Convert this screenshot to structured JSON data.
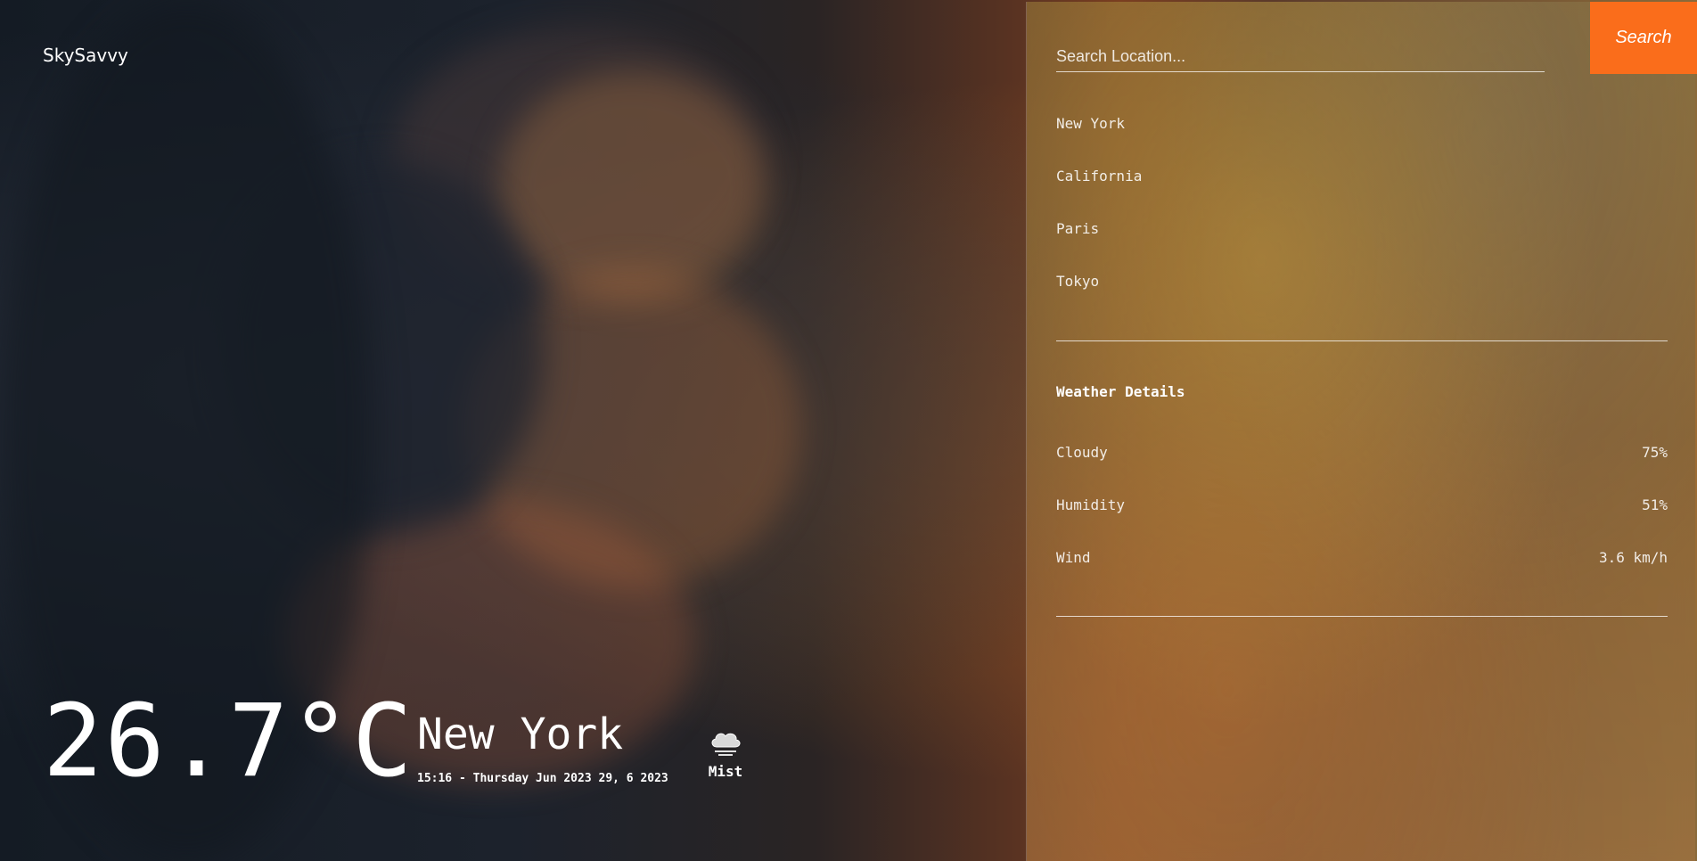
{
  "brand": {
    "name": "SkySavvy"
  },
  "current": {
    "temperature": "26.7°C",
    "city": "New York",
    "datetime": "15:16 - Thursday Jun 2023 29, 6 2023",
    "condition": "Mist",
    "icon": "cloud-icon"
  },
  "search": {
    "placeholder": "Search Location...",
    "value": "",
    "button_label": "Search"
  },
  "locations": [
    {
      "label": "New York"
    },
    {
      "label": "California"
    },
    {
      "label": "Paris"
    },
    {
      "label": "Tokyo"
    }
  ],
  "details": {
    "title": "Weather Details",
    "rows": [
      {
        "label": "Cloudy",
        "value": "75%"
      },
      {
        "label": "Humidity",
        "value": "51%"
      },
      {
        "label": "Wind",
        "value": "3.6 km/h"
      }
    ]
  },
  "colors": {
    "accent": "#fa6d1b",
    "text": "#ffffff"
  }
}
